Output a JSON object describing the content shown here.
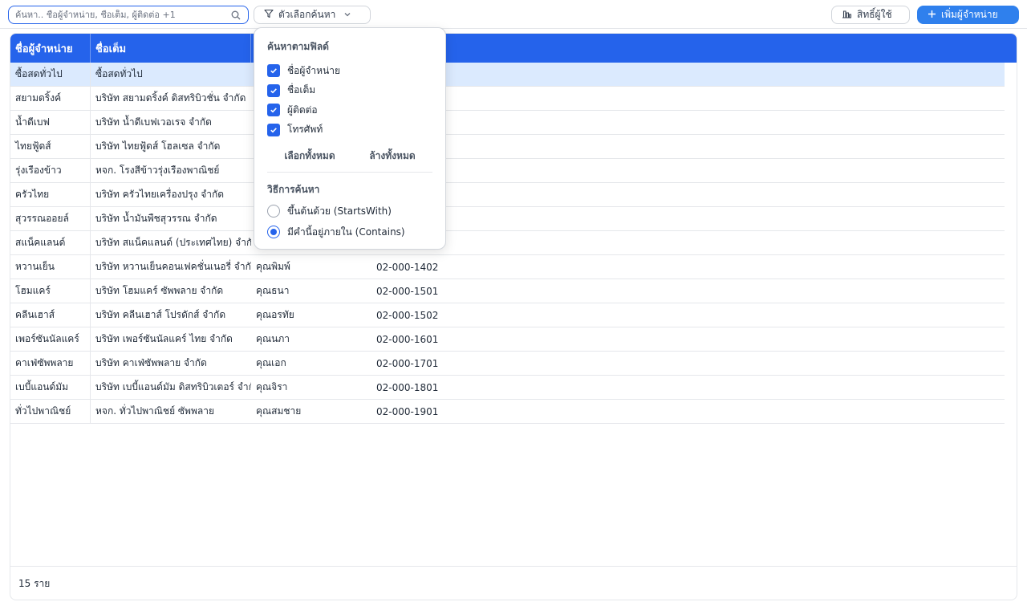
{
  "toolbar": {
    "search_placeholder": "ค้นหา.. ชื่อผู้จำหน่าย, ชื่อเต็ม, ผู้ติดต่อ +1",
    "filter_label": "ตัวเลือกค้นหา",
    "permission_label": "สิทธิ์ผู้ใช้",
    "add_label": "เพิ่มผู้จำหน่าย"
  },
  "table": {
    "columns": [
      "ชื่อผู้จำหน่าย",
      "ชื่อเต็ม",
      "",
      ""
    ],
    "rows": [
      {
        "short": "ซื้อสดทั่วไป",
        "full": "ซื้อสดทั่วไป",
        "contact": "",
        "phone": ""
      },
      {
        "short": "สยามดริ้งค์",
        "full": "บริษัท สยามดริ้งค์ ดิสทริบิวชั่น จำกัด",
        "contact": "",
        "phone": ""
      },
      {
        "short": "น้ำดีเบฟ",
        "full": "บริษัท น้ำดีเบฟเวอเรจ จำกัด",
        "contact": "",
        "phone": ""
      },
      {
        "short": "ไทยฟู้ดส์",
        "full": "บริษัท ไทยฟู้ดส์ โฮลเซล จำกัด",
        "contact": "",
        "phone": ""
      },
      {
        "short": "รุ่งเรืองข้าว",
        "full": "หจก. โรงสีข้าวรุ่งเรืองพาณิชย์",
        "contact": "",
        "phone": ""
      },
      {
        "short": "ครัวไทย",
        "full": "บริษัท ครัวไทยเครื่องปรุง จำกัด",
        "contact": "",
        "phone": ""
      },
      {
        "short": "สุวรรณออยล์",
        "full": "บริษัท น้ำมันพืชสุวรรณ จำกัด",
        "contact": "",
        "phone": ""
      },
      {
        "short": "สแน็คแลนด์",
        "full": "บริษัท สแน็คแลนด์ (ประเทศไทย) จำกัด",
        "contact": "",
        "phone": ""
      },
      {
        "short": "หวานเย็น",
        "full": "บริษัท หวานเย็นคอนเฟคชั่นเนอรี่ จำกัด",
        "contact": "คุณพิมพ์",
        "phone": "02-000-1402"
      },
      {
        "short": "โฮมแคร์",
        "full": "บริษัท โฮมแคร์ ซัพพลาย จำกัด",
        "contact": "คุณธนา",
        "phone": "02-000-1501"
      },
      {
        "short": "คลีนเฮาส์",
        "full": "บริษัท คลีนเฮาส์ โปรดักส์ จำกัด",
        "contact": "คุณอรทัย",
        "phone": "02-000-1502"
      },
      {
        "short": "เพอร์ซันนัลแคร์",
        "full": "บริษัท เพอร์ซันนัลแคร์ ไทย จำกัด",
        "contact": "คุณนภา",
        "phone": "02-000-1601"
      },
      {
        "short": "คาเฟ่ซัพพลาย",
        "full": "บริษัท คาเฟ่ซัพพลาย จำกัด",
        "contact": "คุณเอก",
        "phone": "02-000-1701"
      },
      {
        "short": "เบบี้แอนด์มัม",
        "full": "บริษัท เบบี้แอนด์มัม ดิสทริบิวเตอร์ จำกัด",
        "contact": "คุณจิรา",
        "phone": "02-000-1801"
      },
      {
        "short": "ทั่วไปพาณิชย์",
        "full": "หจก. ทั่วไปพาณิชย์ ซัพพลาย",
        "contact": "คุณสมชาย",
        "phone": "02-000-1901"
      }
    ],
    "footer": "15 ราย"
  },
  "panel": {
    "title": "ค้นหาตามฟิลด์",
    "fields": [
      "ชื่อผู้จำหน่าย",
      "ชื่อเต็ม",
      "ผู้ติดต่อ",
      "โทรศัพท์"
    ],
    "select_all": "เลือกทั้งหมด",
    "clear_all": "ล้างทั้งหมด",
    "method_title": "วิธีการค้นหา",
    "methods": [
      "ขึ้นต้นด้วย (StartsWith)",
      "มีคำนี้อยู่ภายใน (Contains)"
    ],
    "selected_method_index": 1
  },
  "colors": {
    "accent": "#2563eb",
    "add_button": "#2f80ed",
    "selected_row": "#dbeafe"
  },
  "icons": {
    "search": "search-icon",
    "filter": "filter-icon",
    "chevron": "chevron-down-icon",
    "permission": "chart-icon",
    "add": "plus-icon"
  }
}
